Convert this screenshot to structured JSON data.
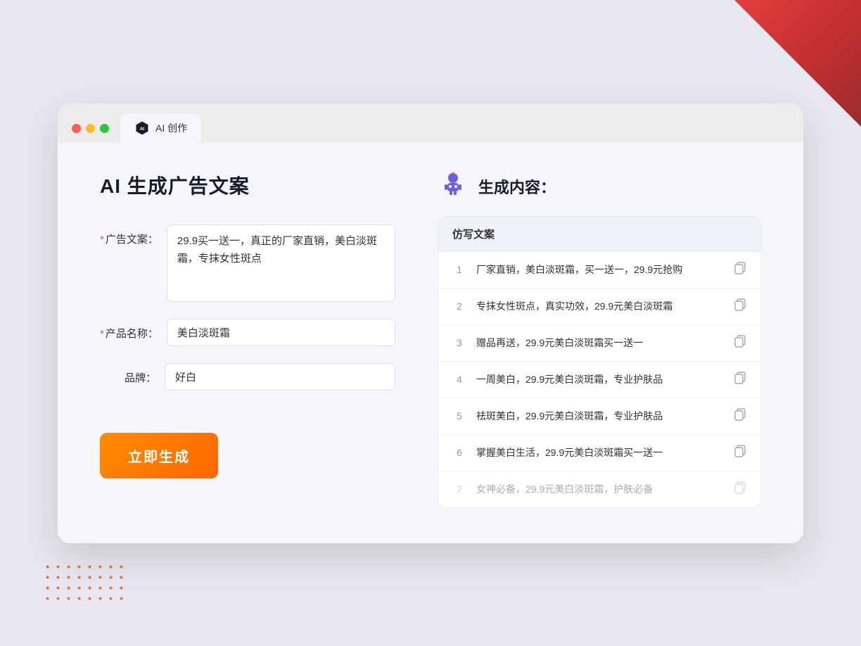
{
  "window": {
    "tab_label": "AI 创作",
    "controls": {
      "close": "close",
      "minimize": "minimize",
      "maximize": "maximize"
    }
  },
  "left_panel": {
    "title": "AI 生成广告文案",
    "form": {
      "ad_copy_label": "广告文案：",
      "ad_copy_required": "*",
      "ad_copy_value": "29.9买一送一，真正的厂家直销，美白淡斑霜，专抹女性斑点",
      "product_name_label": "产品名称：",
      "product_name_required": "*",
      "product_name_value": "美白淡斑霜",
      "brand_label": "品牌：",
      "brand_value": "好白"
    },
    "generate_btn": "立即生成"
  },
  "right_panel": {
    "title": "生成内容：",
    "table_header": "仿写文案",
    "rows": [
      {
        "number": "1",
        "text": "厂家直销，美白淡斑霜，买一送一，29.9元抢购",
        "faded": false
      },
      {
        "number": "2",
        "text": "专抹女性斑点，真实功效，29.9元美白淡斑霜",
        "faded": false
      },
      {
        "number": "3",
        "text": "赠品再送，29.9元美白淡斑霜买一送一",
        "faded": false
      },
      {
        "number": "4",
        "text": "一周美白，29.9元美白淡斑霜，专业护肤品",
        "faded": false
      },
      {
        "number": "5",
        "text": "祛斑美白，29.9元美白淡斑霜，专业护肤品",
        "faded": false
      },
      {
        "number": "6",
        "text": "掌握美白生活，29.9元美白淡斑霜买一送一",
        "faded": false
      },
      {
        "number": "7",
        "text": "女神必备，29.9元美白淡斑霜，护肤必备",
        "faded": true
      }
    ]
  },
  "icons": {
    "tab_icon": "AI",
    "robot": "🤖",
    "copy": "📋"
  }
}
